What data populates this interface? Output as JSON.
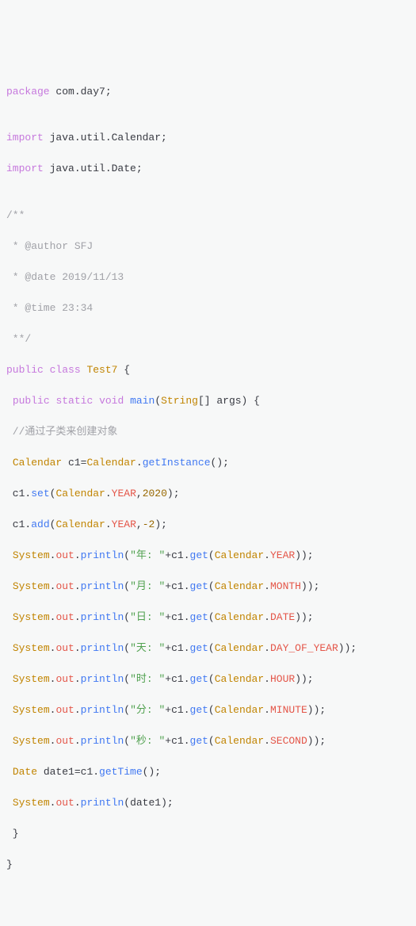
{
  "code": {
    "l1": {
      "kw1": "package",
      "pkg": " com.day7;"
    },
    "l2": "",
    "l3": {
      "kw1": "import",
      "rest": " java.util.Calendar;"
    },
    "l4": {
      "kw1": "import",
      "rest": " java.util.Date;"
    },
    "l5": "",
    "l6": "/**",
    "l7": " * @author SFJ",
    "l8": " * @date 2019/11/13",
    "l9": " * @time 23:34",
    "l10": " **/",
    "l11": {
      "kw1": "public",
      "sp1": " ",
      "kw2": "class",
      "sp2": " ",
      "cls": "Test7",
      "rest": " {"
    },
    "l12": {
      "pre": " ",
      "kw1": "public",
      "sp1": " ",
      "kw2": "static",
      "sp2": " ",
      "kw3": "void",
      "sp3": " ",
      "m": "main",
      "p1": "(",
      "t": "String",
      "arr": "[] args) {"
    },
    "l13": " //通过子类来创建对象",
    "l14": {
      "pre": " ",
      "t": "Calendar",
      "sp": " c1=",
      "t2": "Calendar",
      "dot": ".",
      "m": "getInstance",
      "end": "();"
    },
    "l15": {
      "pre": " c1.",
      "m": "set",
      "p1": "(",
      "t": "Calendar",
      "dot": ".",
      "f": "YEAR",
      "c": ",",
      "n": "2020",
      "end": ");"
    },
    "l16": {
      "pre": " c1.",
      "m": "add",
      "p1": "(",
      "t": "Calendar",
      "dot": ".",
      "f": "YEAR",
      "c": ",",
      "n": "-2",
      "end": ");"
    },
    "l17": {
      "pre": " ",
      "t": "System",
      "d1": ".",
      "f1": "out",
      "d2": ".",
      "m": "println",
      "p1": "(",
      "s": "\"年: \"",
      "plus": "+c1.",
      "m2": "get",
      "p2": "(",
      "t2": "Calendar",
      "d3": ".",
      "f2": "YEAR",
      "end": "));"
    },
    "l18": {
      "pre": " ",
      "t": "System",
      "d1": ".",
      "f1": "out",
      "d2": ".",
      "m": "println",
      "p1": "(",
      "s": "\"月: \"",
      "plus": "+c1.",
      "m2": "get",
      "p2": "(",
      "t2": "Calendar",
      "d3": ".",
      "f2": "MONTH",
      "end": "));"
    },
    "l19": {
      "pre": " ",
      "t": "System",
      "d1": ".",
      "f1": "out",
      "d2": ".",
      "m": "println",
      "p1": "(",
      "s": "\"日: \"",
      "plus": "+c1.",
      "m2": "get",
      "p2": "(",
      "t2": "Calendar",
      "d3": ".",
      "f2": "DATE",
      "end": "));"
    },
    "l20": {
      "pre": " ",
      "t": "System",
      "d1": ".",
      "f1": "out",
      "d2": ".",
      "m": "println",
      "p1": "(",
      "s": "\"天: \"",
      "plus": "+c1.",
      "m2": "get",
      "p2": "(",
      "t2": "Calendar",
      "d3": ".",
      "f2": "DAY_OF_YEAR",
      "end": "));"
    },
    "l21": {
      "pre": " ",
      "t": "System",
      "d1": ".",
      "f1": "out",
      "d2": ".",
      "m": "println",
      "p1": "(",
      "s": "\"时: \"",
      "plus": "+c1.",
      "m2": "get",
      "p2": "(",
      "t2": "Calendar",
      "d3": ".",
      "f2": "HOUR",
      "end": "));"
    },
    "l22": {
      "pre": " ",
      "t": "System",
      "d1": ".",
      "f1": "out",
      "d2": ".",
      "m": "println",
      "p1": "(",
      "s": "\"分: \"",
      "plus": "+c1.",
      "m2": "get",
      "p2": "(",
      "t2": "Calendar",
      "d3": ".",
      "f2": "MINUTE",
      "end": "));"
    },
    "l23": {
      "pre": " ",
      "t": "System",
      "d1": ".",
      "f1": "out",
      "d2": ".",
      "m": "println",
      "p1": "(",
      "s": "\"秒: \"",
      "plus": "+c1.",
      "m2": "get",
      "p2": "(",
      "t2": "Calendar",
      "d3": ".",
      "f2": "SECOND",
      "end": "));"
    },
    "l24": {
      "pre": " ",
      "t": "Date",
      "rest": " date1=c1.",
      "m": "getTime",
      "end": "();"
    },
    "l25": {
      "pre": " ",
      "t": "System",
      "d1": ".",
      "f1": "out",
      "d2": ".",
      "m": "println",
      "rest": "(date1);"
    },
    "l26": " }",
    "l27": "}"
  }
}
